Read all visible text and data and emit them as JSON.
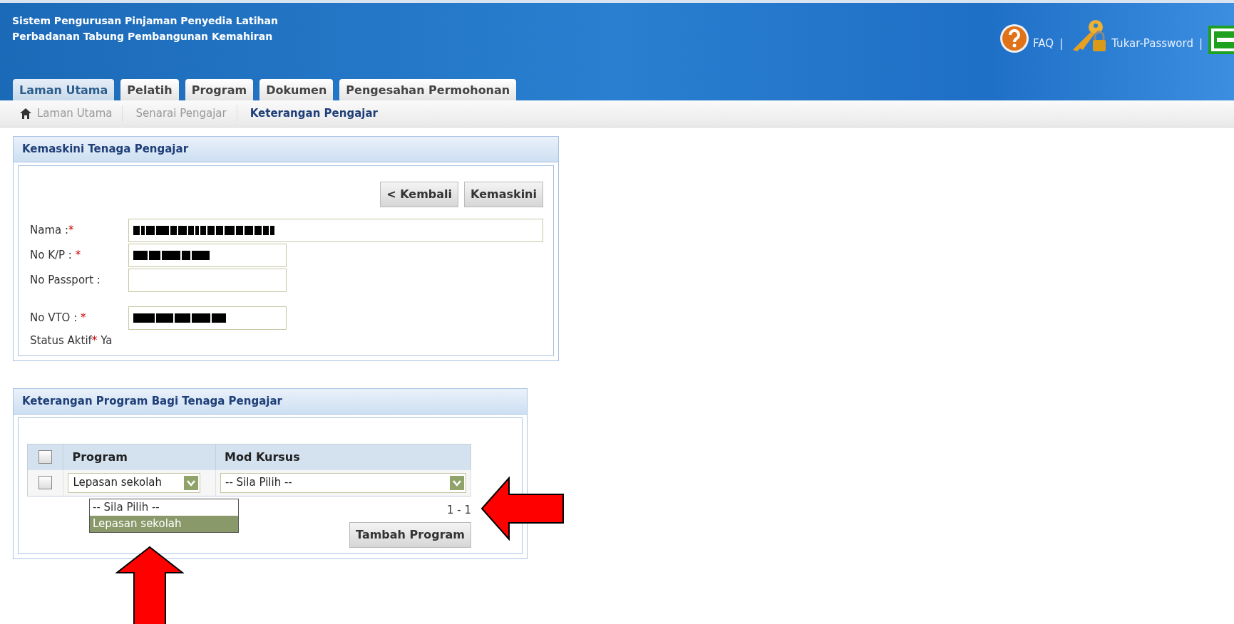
{
  "header": {
    "title_lines": [
      "Sistem Pengurusan Pinjaman Penyedia Latihan",
      "Perbadanan Tabung Pembangunan Kemahiran"
    ],
    "links": [
      {
        "kind": "help",
        "label": "FAQ"
      },
      {
        "kind": "key",
        "label": "Tukar-Password"
      },
      {
        "kind": "exit"
      }
    ],
    "separator": "|"
  },
  "tabs": [
    {
      "label": "Laman Utama",
      "selected": true
    },
    {
      "label": "Pelatih",
      "selected": false
    },
    {
      "label": "Program",
      "selected": false
    },
    {
      "label": "Dokumen",
      "selected": false
    },
    {
      "label": "Pengesahan Permohonan",
      "selected": false
    }
  ],
  "breadcrumb": [
    {
      "label": "Laman Utama",
      "current": false
    },
    {
      "label": "Senarai Pengajar",
      "current": false
    },
    {
      "label": "Keterangan Pengajar",
      "current": true
    }
  ],
  "panel_1": {
    "title": "Kemaskini Tenaga Pengajar",
    "buttons": [
      "< Kembali",
      "Kemaskini"
    ],
    "fields": [
      {
        "label": "Nama :",
        "mark": "*",
        "kind": "wide",
        "redacted": true
      },
      {
        "label": "No K/P : ",
        "mark": "*",
        "kind": "narrow",
        "redacted": true
      },
      {
        "label": "No Passport :",
        "kind": "narrow",
        "redacted": false
      },
      {
        "label": "No VTO : ",
        "mark": "*",
        "kind": "narrow",
        "redacted": true
      }
    ],
    "status": {
      "label": "Status Aktif",
      "mark": "*",
      "value": "Ya"
    }
  },
  "panel_2": {
    "title": "Keterangan Program Bagi Tenaga Pengajar",
    "table": {
      "columns": [
        "Program",
        "Mod Kursus"
      ],
      "header_checked": false,
      "rows": [
        {
          "checked": false,
          "program": "Lepasan sekolah",
          "mod_kursus": "-- Sila Pilih --"
        }
      ]
    },
    "dropdown": {
      "expanded": true,
      "options": [
        {
          "label": "-- Sila Pilih --",
          "selected": false
        },
        {
          "label": "Lepasan sekolah",
          "selected": true
        }
      ]
    },
    "pager": "1 - 1",
    "button": "Tambah Program"
  },
  "annotations": [
    {
      "kind": "arrow-up"
    },
    {
      "kind": "arrow-left"
    }
  ]
}
